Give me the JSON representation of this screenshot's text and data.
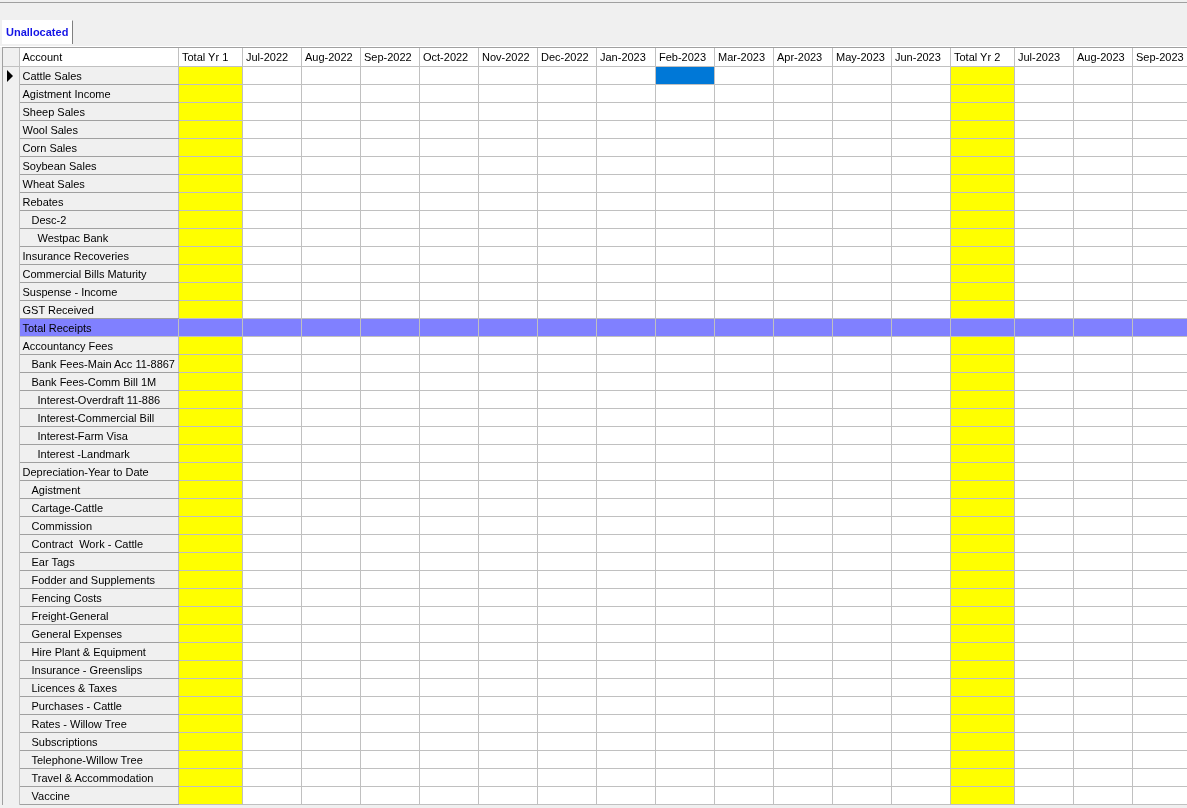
{
  "tabs": [
    {
      "label": "Unallocated",
      "selected": true
    }
  ],
  "table": {
    "columns": [
      {
        "label": "Account",
        "kind": "account",
        "selected": false
      },
      {
        "label": "Total Yr 1",
        "kind": "total",
        "selected": false
      },
      {
        "label": "Jul-2022",
        "kind": "month",
        "selected": false
      },
      {
        "label": "Aug-2022",
        "kind": "month",
        "selected": false
      },
      {
        "label": "Sep-2022",
        "kind": "month",
        "selected": false
      },
      {
        "label": "Oct-2022",
        "kind": "month",
        "selected": false
      },
      {
        "label": "Nov-2022",
        "kind": "month",
        "selected": false
      },
      {
        "label": "Dec-2022",
        "kind": "month",
        "selected": false
      },
      {
        "label": "Jan-2023",
        "kind": "month",
        "selected": false
      },
      {
        "label": "Feb-2023",
        "kind": "month",
        "selected": true
      },
      {
        "label": "Mar-2023",
        "kind": "month",
        "selected": false
      },
      {
        "label": "Apr-2023",
        "kind": "month",
        "selected": false
      },
      {
        "label": "May-2023",
        "kind": "month",
        "selected": false
      },
      {
        "label": "Jun-2023",
        "kind": "month",
        "selected": false
      },
      {
        "label": "Total Yr 2",
        "kind": "total",
        "selected": false
      },
      {
        "label": "Jul-2023",
        "kind": "month",
        "selected": false
      },
      {
        "label": "Aug-2023",
        "kind": "month",
        "selected": false
      },
      {
        "label": "Sep-2023",
        "kind": "month",
        "selected": false
      }
    ],
    "rows": [
      {
        "name": "Cattle Sales",
        "kind": "account",
        "selected": true
      },
      {
        "name": "Agistment Income",
        "kind": "account",
        "selected": false
      },
      {
        "name": "Sheep Sales",
        "kind": "account",
        "selected": false
      },
      {
        "name": "Wool Sales",
        "kind": "account",
        "selected": false
      },
      {
        "name": "Corn Sales",
        "kind": "account",
        "selected": false
      },
      {
        "name": "Soybean Sales",
        "kind": "account",
        "selected": false
      },
      {
        "name": "Wheat Sales",
        "kind": "account",
        "selected": false
      },
      {
        "name": "Rebates",
        "kind": "account",
        "selected": false,
        "children": [
          {
            "name": "Desc-2",
            "kind": "account",
            "selected": false,
            "children": [
              {
                "name": "Westpac Bank",
                "kind": "account",
                "selected": false
              }
            ]
          }
        ]
      },
      {
        "name": "Insurance Recoveries",
        "kind": "account",
        "selected": false
      },
      {
        "name": "Commercial Bills Maturity",
        "kind": "account",
        "selected": false
      },
      {
        "name": "Suspense - Income",
        "kind": "account",
        "selected": false
      },
      {
        "name": "GST Received",
        "kind": "account",
        "selected": false
      },
      {
        "name": "Total Receipts",
        "kind": "total",
        "selected": false
      },
      {
        "name": "Accountancy Fees",
        "kind": "account",
        "selected": false,
        "children": [
          {
            "name": "Bank Fees-Main Acc 11-8867",
            "kind": "account",
            "selected": false
          },
          {
            "name": "Bank Fees-Comm Bill 1M",
            "kind": "account",
            "selected": false,
            "children": [
              {
                "name": "Interest-Overdraft 11-886",
                "kind": "account",
                "selected": false
              },
              {
                "name": "Interest-Commercial Bill",
                "kind": "account",
                "selected": false
              },
              {
                "name": "Interest-Farm Visa",
                "kind": "account",
                "selected": false
              },
              {
                "name": "Interest -Landmark",
                "kind": "account",
                "selected": false
              }
            ]
          }
        ]
      },
      {
        "name": "Depreciation-Year to Date",
        "kind": "account",
        "selected": false,
        "children": [
          {
            "name": "Agistment",
            "kind": "account",
            "selected": false
          },
          {
            "name": "Cartage-Cattle",
            "kind": "account",
            "selected": false
          },
          {
            "name": "Commission",
            "kind": "account",
            "selected": false
          },
          {
            "name": "Contract  Work - Cattle",
            "kind": "account",
            "selected": false
          },
          {
            "name": "Ear Tags",
            "kind": "account",
            "selected": false
          },
          {
            "name": "Fodder and Supplements",
            "kind": "account",
            "selected": false
          },
          {
            "name": "Fencing Costs",
            "kind": "account",
            "selected": false
          },
          {
            "name": "Freight-General",
            "kind": "account",
            "selected": false
          },
          {
            "name": "General Expenses",
            "kind": "account",
            "selected": false
          },
          {
            "name": "Hire Plant & Equipment",
            "kind": "account",
            "selected": false
          },
          {
            "name": "Insurance - Greenslips",
            "kind": "account",
            "selected": false
          },
          {
            "name": "Licences & Taxes",
            "kind": "account",
            "selected": false
          },
          {
            "name": "Purchases - Cattle",
            "kind": "account",
            "selected": false
          },
          {
            "name": "Rates - Willow Tree",
            "kind": "account",
            "selected": false
          },
          {
            "name": "Subscriptions",
            "kind": "account",
            "selected": false
          },
          {
            "name": "Telephone-Willow Tree",
            "kind": "account",
            "selected": false
          },
          {
            "name": "Travel & Accommodation",
            "kind": "account",
            "selected": false
          },
          {
            "name": "Vaccine",
            "kind": "account",
            "selected": false
          }
        ]
      }
    ]
  }
}
